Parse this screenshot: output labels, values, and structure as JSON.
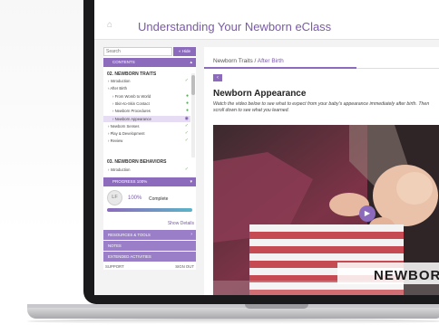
{
  "app": {
    "title": "Understanding Your Newborn eClass"
  },
  "sidebar": {
    "search_placeholder": "Search",
    "hide_label": "« Hide",
    "contents_label": "CONTENTS",
    "module2_heading": "02. NEWBORN TRAITS",
    "module2_items": [
      {
        "label": "Introduction",
        "status": "check"
      },
      {
        "label": "After Birth",
        "status": "none"
      },
      {
        "label": "From Womb to World",
        "status": "dot"
      },
      {
        "label": "Skin-to-Skin Contact",
        "status": "dot"
      },
      {
        "label": "Newborn Procedures",
        "status": "dot"
      },
      {
        "label": "Newborn Appearance",
        "status": "current"
      },
      {
        "label": "Newborn Senses",
        "status": "check"
      },
      {
        "label": "Play & Development",
        "status": "check"
      },
      {
        "label": "Review",
        "status": "check"
      }
    ],
    "module3_heading": "03. NEWBORN BEHAVIORS",
    "module3_items": [
      {
        "label": "Introduction",
        "status": "check"
      }
    ],
    "progress_label": "PROGRESS 100%",
    "avatar_initials": "LF",
    "progress_value": "100%",
    "progress_fraction": 1.0,
    "complete_label": "Complete",
    "show_details": "Show Details",
    "tools": [
      {
        "label": "RESOURCES & TOOLS"
      },
      {
        "label": "NOTES"
      },
      {
        "label": "EXTENDED ACTIVITIES"
      }
    ],
    "support_label": "SUPPORT",
    "signout_label": "SIGN OUT"
  },
  "main": {
    "breadcrumb_parent": "Newborn Traits",
    "breadcrumb_sep": " / ",
    "breadcrumb_current": "After Birth",
    "back_label": "‹",
    "title": "Newborn Appearance",
    "description": "Watch the video below to see what to expect from your baby's appearance immediately after birth. Then scroll down to see what you learned.",
    "video_caption": "NEWBORN",
    "play_icon": "▶"
  },
  "colors": {
    "accent": "#8c6bbd",
    "brand_text": "#7a5aa8",
    "done": "#6cbf4f",
    "promo": "#f0573a"
  }
}
